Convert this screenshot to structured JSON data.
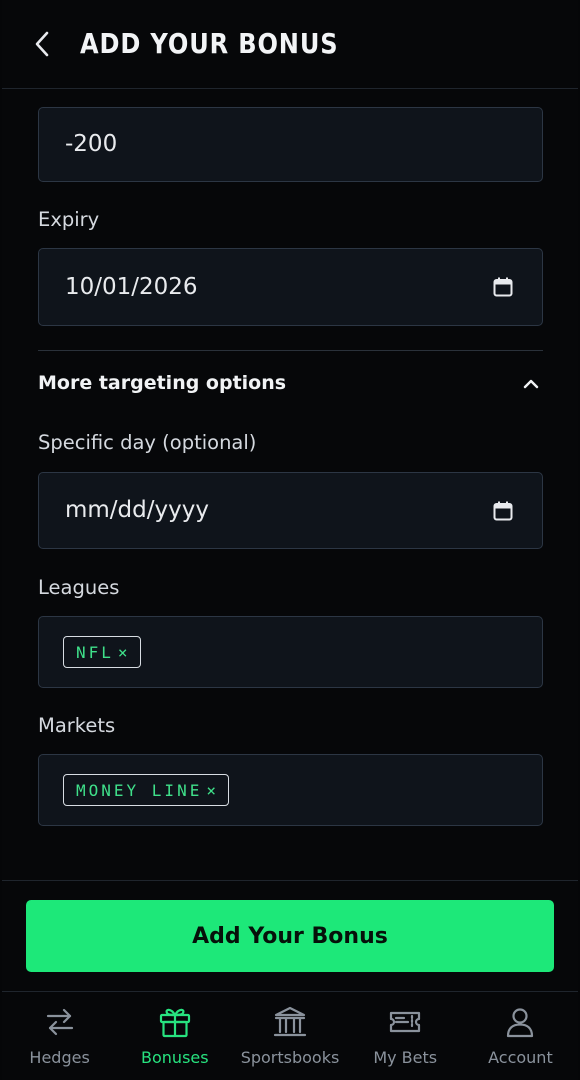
{
  "header": {
    "title": "ADD YOUR BONUS",
    "back_icon": "chevron-left-icon"
  },
  "form": {
    "odds_value": "-200",
    "expiry": {
      "label": "Expiry",
      "value": "10/01/2026"
    },
    "more_options": {
      "label": "More targeting options",
      "expanded": true
    },
    "specific_day": {
      "label": "Specific day (optional)",
      "placeholder": "mm/dd/yyyy"
    },
    "leagues": {
      "label": "Leagues",
      "tags": [
        "NFL"
      ]
    },
    "markets": {
      "label": "Markets",
      "tags": [
        "MONEY LINE"
      ]
    },
    "tag_remove": "×"
  },
  "actions": {
    "submit_label": "Add Your Bonus"
  },
  "nav": {
    "items": [
      {
        "label": "Hedges",
        "icon": "arrows-swap-icon",
        "active": false
      },
      {
        "label": "Bonuses",
        "icon": "gift-icon",
        "active": true
      },
      {
        "label": "Sportsbooks",
        "icon": "bank-icon",
        "active": false
      },
      {
        "label": "My Bets",
        "icon": "ticket-icon",
        "active": false
      },
      {
        "label": "Account",
        "icon": "user-icon",
        "active": false
      }
    ]
  },
  "colors": {
    "accent": "#1de879",
    "background": "#060709",
    "field_bg": "#0f141b",
    "field_border": "#2c3644",
    "muted": "#8a929c"
  }
}
